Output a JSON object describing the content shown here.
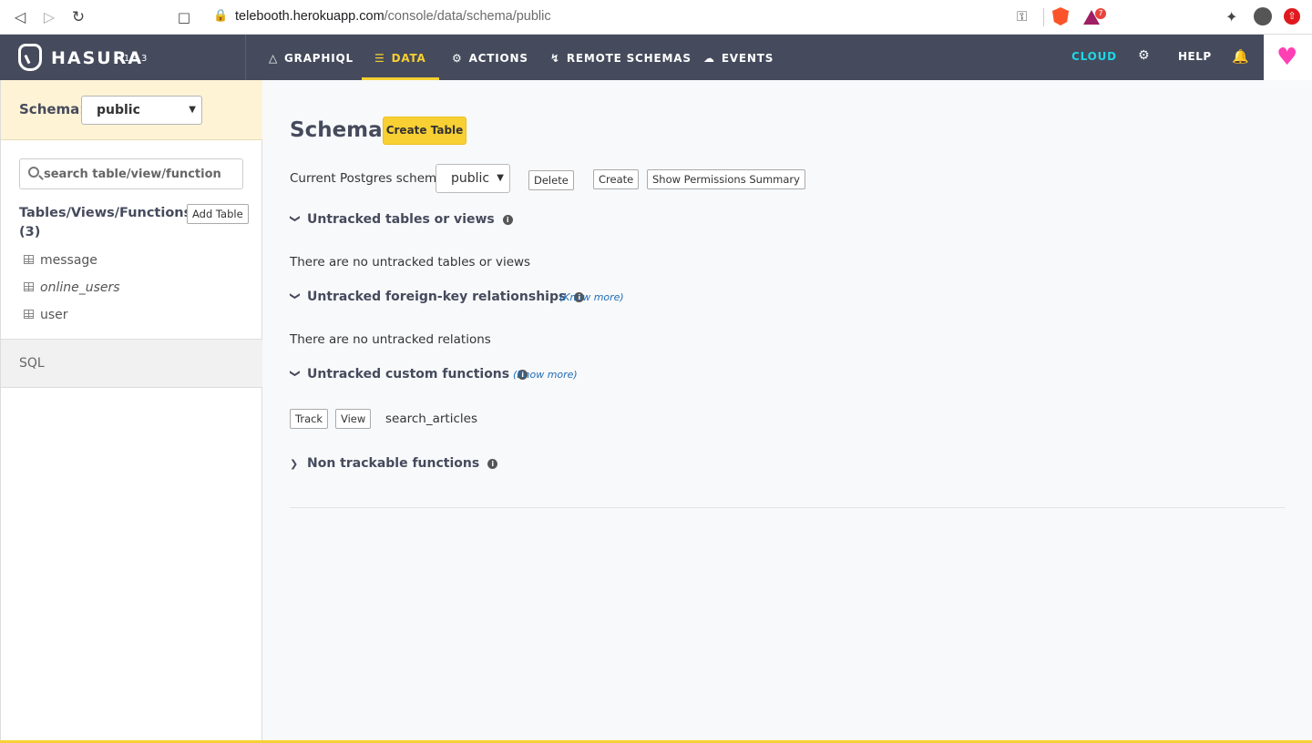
{
  "browser": {
    "url_host": "telebooth.herokuapp.com",
    "url_path": "/console/data/schema/public",
    "ext_badge": "7"
  },
  "navbar": {
    "brand": "HASURA",
    "version": "v1.3.3",
    "items": [
      {
        "label": "GRAPHIQL",
        "icon": "flask-icon"
      },
      {
        "label": "DATA",
        "icon": "database-icon",
        "active": true
      },
      {
        "label": "ACTIONS",
        "icon": "cogs-icon"
      },
      {
        "label": "REMOTE SCHEMAS",
        "icon": "plug-icon"
      },
      {
        "label": "EVENTS",
        "icon": "cloud-icon"
      }
    ],
    "cloud": "CLOUD",
    "help": "HELP",
    "accent_color": "#f8d033",
    "cloud_color": "#1fd6e5"
  },
  "sidebar": {
    "schema_label": "Schema:",
    "schema_value": "public",
    "search_placeholder": "search table/view/function",
    "tvf_title": "Tables/Views/Functions (3)",
    "add_table": "Add Table",
    "tables": [
      {
        "name": "message",
        "type": "table"
      },
      {
        "name": "online_users",
        "type": "view"
      },
      {
        "name": "user",
        "type": "table"
      }
    ],
    "sql": "SQL"
  },
  "main": {
    "title": "Schema",
    "create_table": "Create Table",
    "pg_schema_label": "Current Postgres schema",
    "pg_schema_value": "public",
    "delete": "Delete",
    "create": "Create",
    "show_permissions": "Show Permissions Summary",
    "sections": {
      "untracked_tables": {
        "title": "Untracked tables or views",
        "empty": "There are no untracked tables or views"
      },
      "untracked_fk": {
        "title": "Untracked foreign-key relationships",
        "know_more": "(Know more)",
        "empty": "There are no untracked relations"
      },
      "untracked_functions": {
        "title": "Untracked custom functions",
        "know_more": "(Know more)",
        "track": "Track",
        "view": "View",
        "function_name": "search_articles"
      },
      "non_trackable": {
        "title": "Non trackable functions"
      }
    }
  }
}
